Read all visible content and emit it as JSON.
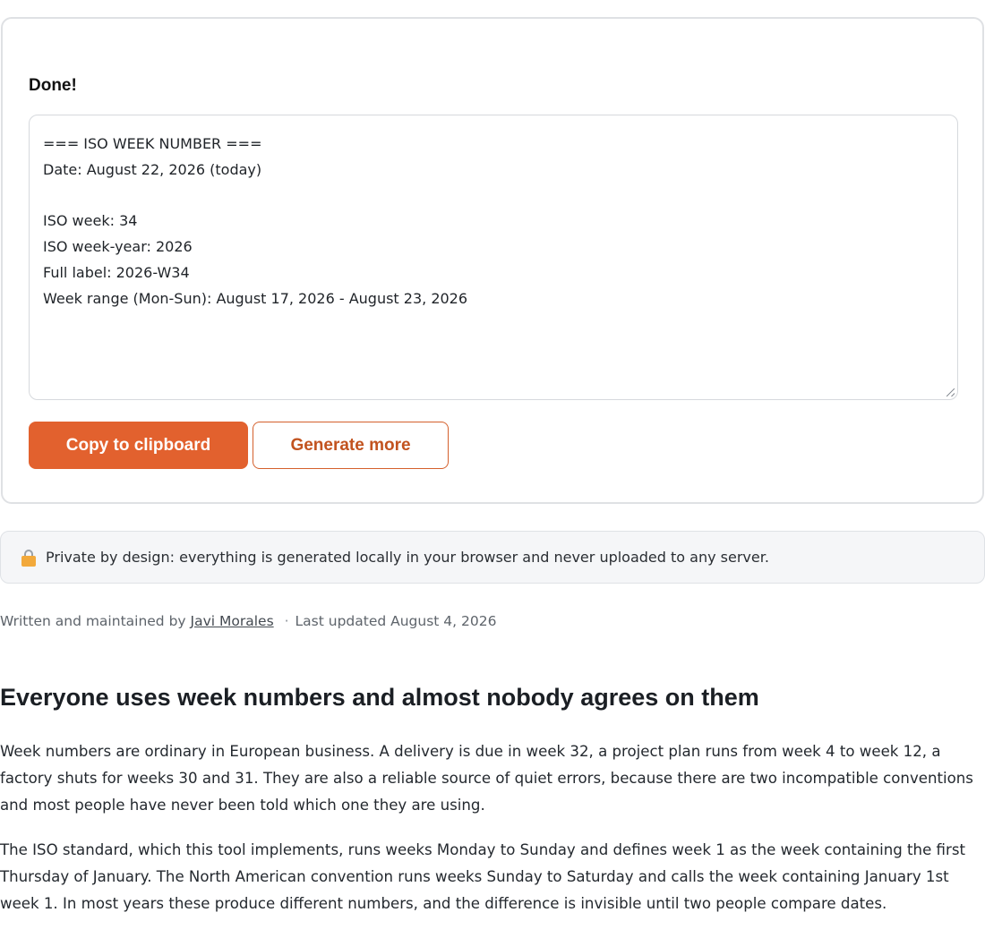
{
  "result": {
    "status": "Done!",
    "output_lines": [
      "=== ISO WEEK NUMBER ===",
      "Date: August 22, 2026 (today)",
      "",
      "ISO week: 34",
      "ISO week-year: 2026",
      "Full label: 2026-W34",
      "Week range (Mon-Sun): August 17, 2026 - August 23, 2026"
    ],
    "copy_label": "Copy to clipboard",
    "more_label": "Generate more"
  },
  "privacy": {
    "icon": "lock-icon",
    "text": "Private by design: everything is generated locally in your browser and never uploaded to any server."
  },
  "byline": {
    "prefix": "Written and maintained by",
    "author": "Javi Morales",
    "separator": "·",
    "updated": "Last updated August 4, 2026"
  },
  "article": {
    "heading": "Everyone uses week numbers and almost nobody agrees on them",
    "paragraphs": [
      "Week numbers are ordinary in European business. A delivery is due in week 32, a project plan runs from week 4 to week 12, a factory shuts for weeks 30 and 31. They are also a reliable source of quiet errors, because there are two incompatible conventions and most people have never been told which one they are using.",
      "The ISO standard, which this tool implements, runs weeks Monday to Sunday and defines week 1 as the week containing the first Thursday of January. The North American convention runs weeks Sunday to Saturday and calls the week containing January 1st week 1. In most years these produce different numbers, and the difference is invisible until two people compare dates."
    ]
  },
  "colors": {
    "accent": "#e2612e",
    "accent_text": "#c2531f"
  }
}
